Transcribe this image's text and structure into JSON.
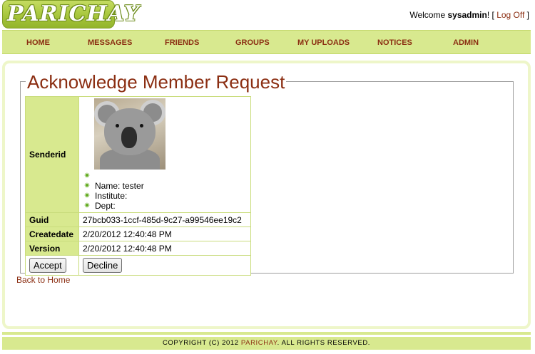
{
  "header": {
    "logo_text": "PARICHAY",
    "welcome_prefix": "Welcome ",
    "username": "sysadmin",
    "welcome_suffix": "! [ ",
    "logout_label": "Log Off",
    "logout_suffix": " ]"
  },
  "nav": {
    "items": [
      {
        "label": "HOME"
      },
      {
        "label": "MESSAGES"
      },
      {
        "label": "FRIENDS"
      },
      {
        "label": "GROUPS"
      },
      {
        "label": "MY UPLOADS"
      },
      {
        "label": "NOTICES"
      },
      {
        "label": "ADMIN"
      }
    ]
  },
  "page": {
    "title": "Acknowledge Member Request",
    "back_link": "Back to Home"
  },
  "details": {
    "senderid_label": "Senderid",
    "sender_photo_icon": "koala-photo",
    "sender_name": "Name: tester",
    "sender_institute": "Institute:",
    "sender_dept": "Dept:",
    "guid_label": "Guid",
    "guid_value": "27bcb033-1ccf-485d-9c27-a99546ee19c2",
    "createdate_label": "Createdate",
    "createdate_value": "2/20/2012 12:40:48 PM",
    "version_label": "Version",
    "version_value": "2/20/2012 12:40:48 PM"
  },
  "actions": {
    "accept_label": "Accept",
    "decline_label": "Decline"
  },
  "footer": {
    "prefix": "COPYRIGHT (C) 2012 ",
    "brand": "PARICHAY",
    "suffix": ". ALL RIGHTS RESERVED."
  },
  "colors": {
    "accent_green": "#d8e98f",
    "brand_brown": "#8b2e12",
    "bullet_green": "#5ea81a"
  }
}
